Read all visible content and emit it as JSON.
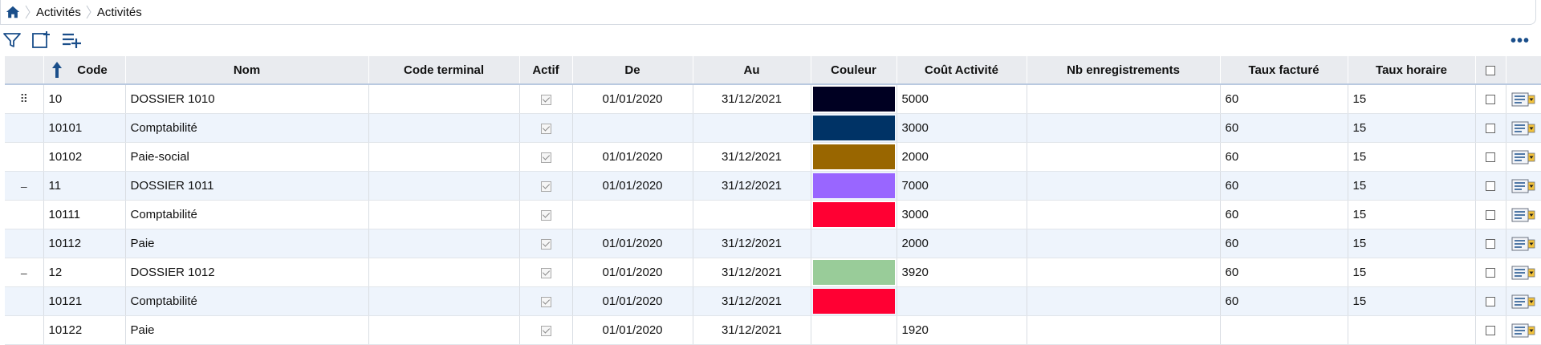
{
  "breadcrumb": {
    "items": [
      "Activités",
      "Activités"
    ]
  },
  "toolbar": {
    "filter_icon": "filter-icon",
    "new_icon": "new-document-icon",
    "add_list_icon": "add-list-icon",
    "more_label": "•••"
  },
  "table": {
    "columns": {
      "code": "Code",
      "nom": "Nom",
      "code_terminal": "Code terminal",
      "actif": "Actif",
      "de": "De",
      "au": "Au",
      "couleur": "Couleur",
      "cout_activite": "Coût Activité",
      "nb_enregistrements": "Nb enregistrements",
      "taux_facture": "Taux facturé",
      "taux_horaire": "Taux horaire"
    },
    "sort": {
      "column": "Code",
      "direction": "ascending"
    },
    "rows": [
      {
        "expander": "⠿",
        "code": "10",
        "nom": "DOSSIER 1010",
        "code_terminal": "",
        "actif": true,
        "de": "01/01/2020",
        "au": "31/12/2021",
        "couleur": "#000022",
        "cout": "5000",
        "nb": "",
        "taux_facture": "60",
        "taux_horaire": "15"
      },
      {
        "expander": "",
        "code": "10101",
        "nom": "Comptabilité",
        "code_terminal": "",
        "actif": true,
        "de": "",
        "au": "",
        "couleur": "#003366",
        "cout": "3000",
        "nb": "",
        "taux_facture": "60",
        "taux_horaire": "15"
      },
      {
        "expander": "",
        "code": "10102",
        "nom": "Paie-social",
        "code_terminal": "",
        "actif": true,
        "de": "01/01/2020",
        "au": "31/12/2021",
        "couleur": "#996600",
        "cout": "2000",
        "nb": "",
        "taux_facture": "60",
        "taux_horaire": "15"
      },
      {
        "expander": "–",
        "code": "11",
        "nom": "DOSSIER 1011",
        "code_terminal": "",
        "actif": true,
        "de": "01/01/2020",
        "au": "31/12/2021",
        "couleur": "#9966ff",
        "cout": "7000",
        "nb": "",
        "taux_facture": "60",
        "taux_horaire": "15"
      },
      {
        "expander": "",
        "code": "10111",
        "nom": "Comptabilité",
        "code_terminal": "",
        "actif": true,
        "de": "",
        "au": "",
        "couleur": "#ff0033",
        "cout": "3000",
        "nb": "",
        "taux_facture": "60",
        "taux_horaire": "15"
      },
      {
        "expander": "",
        "code": "10112",
        "nom": "Paie",
        "code_terminal": "",
        "actif": true,
        "de": "01/01/2020",
        "au": "31/12/2021",
        "couleur": "",
        "cout": "2000",
        "nb": "",
        "taux_facture": "60",
        "taux_horaire": "15"
      },
      {
        "expander": "–",
        "code": "12",
        "nom": "DOSSIER 1012",
        "code_terminal": "",
        "actif": true,
        "de": "01/01/2020",
        "au": "31/12/2021",
        "couleur": "#99cc99",
        "cout": "3920",
        "nb": "",
        "taux_facture": "60",
        "taux_horaire": "15"
      },
      {
        "expander": "",
        "code": "10121",
        "nom": "Comptabilité",
        "code_terminal": "",
        "actif": true,
        "de": "01/01/2020",
        "au": "31/12/2021",
        "couleur": "#ff0033",
        "cout": "",
        "nb": "",
        "taux_facture": "60",
        "taux_horaire": "15"
      },
      {
        "expander": "",
        "code": "10122",
        "nom": "Paie",
        "code_terminal": "",
        "actif": true,
        "de": "01/01/2020",
        "au": "31/12/2021",
        "couleur": "",
        "cout": "1920",
        "nb": "",
        "taux_facture": "",
        "taux_horaire": ""
      }
    ]
  },
  "colors": {
    "accent": "#1a4e8a",
    "header_bg": "#e9ebef",
    "alt_row_bg": "#eef4fc"
  }
}
